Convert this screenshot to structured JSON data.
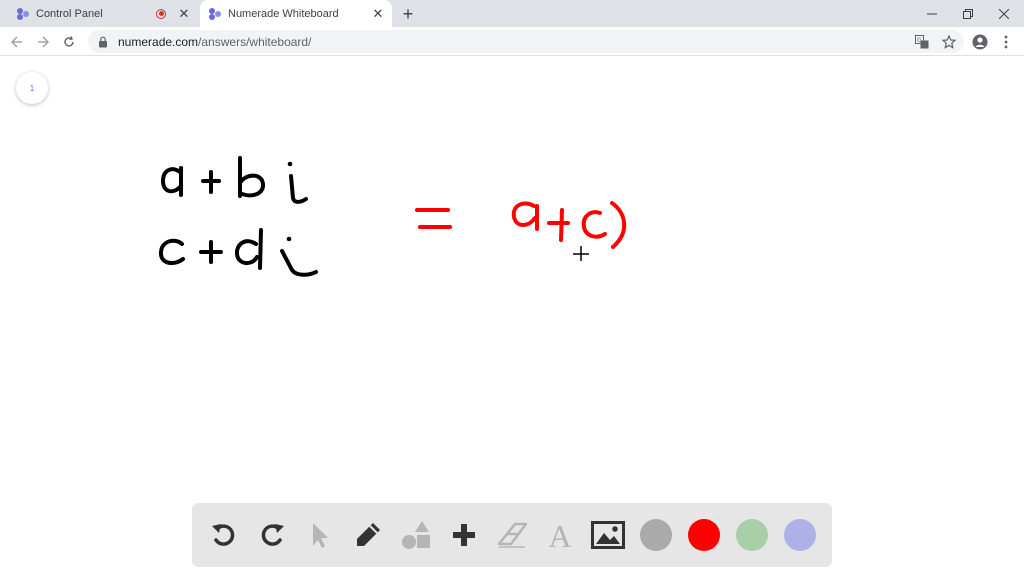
{
  "browser": {
    "tabs": [
      {
        "title": "Control Panel",
        "recording": true
      },
      {
        "title": "Numerade Whiteboard",
        "active": true
      }
    ],
    "address": {
      "host": "numerade.com",
      "path": "/answers/whiteboard/"
    }
  },
  "whiteboard": {
    "page_number": "1",
    "handwriting": {
      "numerator": "a + b i",
      "denominator": "c + d i",
      "equals": "=",
      "result": "a+c)"
    }
  },
  "palette": {
    "tools": [
      "undo-icon",
      "redo-icon",
      "pointer-icon",
      "pencil-icon",
      "shapes-icon",
      "plus-icon",
      "eraser-icon",
      "text-icon",
      "image-icon"
    ],
    "colors": [
      "#aaaaaa",
      "#ff0000",
      "#a8cfa8",
      "#b0b0e8"
    ]
  },
  "theme": {
    "ink_black": "#000000",
    "ink_red": "#ff0000",
    "accent": "#6a6ad8"
  }
}
